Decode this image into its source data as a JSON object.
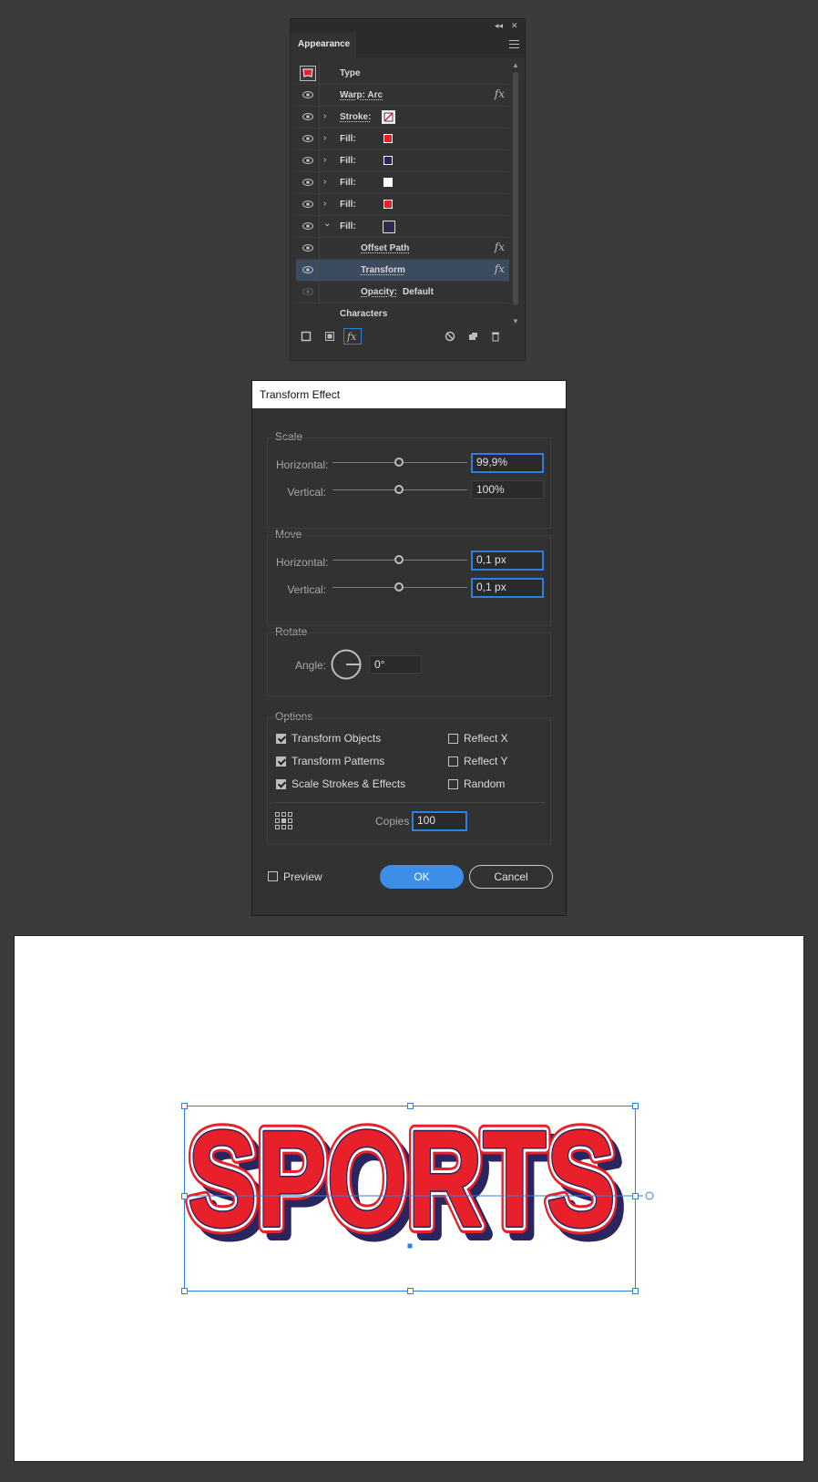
{
  "appearance_panel": {
    "tab": "Appearance",
    "rows": [
      {
        "label": "Type",
        "kind": "header"
      },
      {
        "label": "Warp: Arc",
        "fx": true
      },
      {
        "label": "Stroke:",
        "swatch": "none-red",
        "expand": "›"
      },
      {
        "label": "Fill:",
        "swatch": "#e8202a",
        "expand": "›"
      },
      {
        "label": "Fill:",
        "swatch": "#29255f",
        "expand": "›"
      },
      {
        "label": "Fill:",
        "swatch": "#ffffff",
        "expand": "›"
      },
      {
        "label": "Fill:",
        "swatch": "#e8202a",
        "expand": "›"
      },
      {
        "label": "Fill:",
        "swatch": "#29255f",
        "expand": "⌄"
      },
      {
        "label": "Offset Path",
        "fx": true
      },
      {
        "label": "Transform",
        "fx": true,
        "selected": true
      },
      {
        "label": "Opacity:",
        "value": "Default"
      },
      {
        "label": "Characters"
      }
    ],
    "fx_glyph": "fx"
  },
  "dialog": {
    "title": "Transform Effect",
    "scale": {
      "title": "Scale",
      "horizontal_label": "Horizontal:",
      "horizontal_value": "99,9%",
      "vertical_label": "Vertical:",
      "vertical_value": "100%"
    },
    "move": {
      "title": "Move",
      "horizontal_label": "Horizontal:",
      "horizontal_value": "0,1 px",
      "vertical_label": "Vertical:",
      "vertical_value": "0,1 px"
    },
    "rotate": {
      "title": "Rotate",
      "angle_label": "Angle:",
      "angle_value": "0°"
    },
    "options": {
      "title": "Options",
      "transform_objects": {
        "label": "Transform Objects",
        "checked": true
      },
      "transform_patterns": {
        "label": "Transform Patterns",
        "checked": true
      },
      "scale_strokes": {
        "label": "Scale Strokes & Effects",
        "checked": true
      },
      "reflect_x": {
        "label": "Reflect X",
        "checked": false
      },
      "reflect_y": {
        "label": "Reflect Y",
        "checked": false
      },
      "random": {
        "label": "Random",
        "checked": false
      },
      "copies_label": "Copies",
      "copies_value": "100"
    },
    "preview_label": "Preview",
    "ok_label": "OK",
    "cancel_label": "Cancel"
  },
  "artboard": {
    "text": "SPORTS",
    "colors": {
      "fill": "#e8202a",
      "outline": "#ffffff",
      "shadow": "#29255f",
      "selection": "#2f7fe0"
    }
  }
}
